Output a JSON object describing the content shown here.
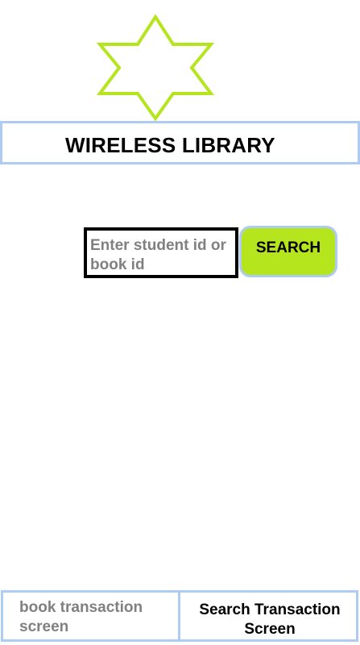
{
  "app": {
    "logo_icon": "six-pointed-star-icon",
    "logo_color": "#b5e61d",
    "accent_border_color": "#aecbf2"
  },
  "header": {
    "title": "WIRELESS LIBRARY"
  },
  "search": {
    "placeholder": "Enter student id or book id",
    "value": "",
    "button_label": "SEARCH",
    "button_color": "#b5e61d"
  },
  "bottom_tabs": [
    {
      "label": "book transaction screen",
      "active": false
    },
    {
      "label": "Search Transaction Screen",
      "active": true
    }
  ]
}
